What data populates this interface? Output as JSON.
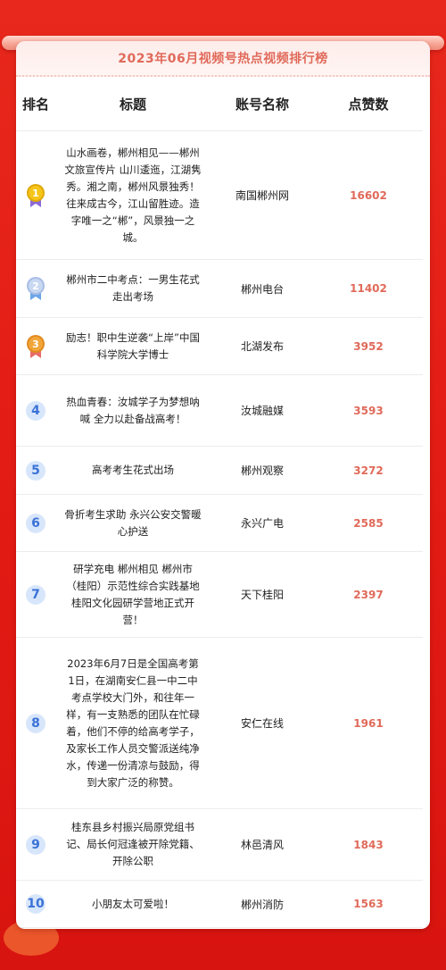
{
  "page": {
    "title": "2023年06月视频号热点视频排行榜"
  },
  "table": {
    "headers": {
      "rank": "排名",
      "title": "标题",
      "account": "账号名称",
      "likes": "点赞数"
    },
    "rows": [
      {
        "rank": "1",
        "medal": "gold",
        "title": "山水画卷，郴州相见——郴州文旅宣传片 山川逶迤，江湖隽秀。湘之南，郴州风景独秀！往来成古今，江山留胜迹。造字唯一之“郴”，风景独一之城。",
        "account": "南国郴州网",
        "likes": "16602"
      },
      {
        "rank": "2",
        "medal": "silver",
        "title": "郴州市二中考点：一男生花式走出考场",
        "account": "郴州电台",
        "likes": "11402"
      },
      {
        "rank": "3",
        "medal": "bronze",
        "title": "励志！职中生逆袭“上岸”中国科学院大学博士",
        "account": "北湖发布",
        "likes": "3952"
      },
      {
        "rank": "4",
        "title": "热血青春：汝城学子为梦想呐喊 全力以赴备战高考！",
        "account": "汝城融媒",
        "likes": "3593"
      },
      {
        "rank": "5",
        "title": "高考考生花式出场",
        "account": "郴州观察",
        "likes": "3272"
      },
      {
        "rank": "6",
        "title": "骨折考生求助 永兴公安交警暖心护送",
        "account": "永兴广电",
        "likes": "2585"
      },
      {
        "rank": "7",
        "title": "研学充电 郴州相见 郴州市（桂阳）示范性综合实践基地桂阳文化园研学营地正式开营！",
        "account": "天下桂阳",
        "likes": "2397"
      },
      {
        "rank": "8",
        "title": "2023年6月7日是全国高考第1日，在湖南安仁县一中二中考点学校大门外，和往年一样，有一支熟悉的团队在忙碌着，他们不停的给高考学子，及家长工作人员交警派送纯净水，传递一份清凉与鼓励，得到大家广泛的称赞。",
        "account": "安仁在线",
        "likes": "1961"
      },
      {
        "rank": "9",
        "title": "桂东县乡村振兴局原党组书记、局长何冠逢被开除党籍、开除公职",
        "account": "林邑清风",
        "likes": "1843"
      },
      {
        "rank": "10",
        "title": "小朋友太可爱啦！",
        "account": "郴州消防",
        "likes": "1563"
      }
    ]
  },
  "colors": {
    "accent": "#e06a5a",
    "background": "#e21a14",
    "rank_badge": "#3a72d6"
  }
}
